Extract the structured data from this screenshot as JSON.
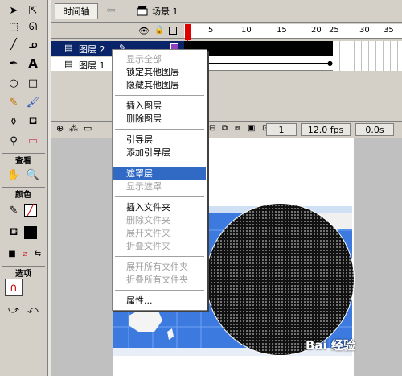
{
  "toolbar": {
    "timeline_button": "时间轴",
    "scene_label": "场景 1"
  },
  "timeline": {
    "ruler_numbers": [
      "1",
      "5",
      "10",
      "15",
      "20",
      "25",
      "30",
      "35"
    ],
    "layers": [
      {
        "name": "图层 2",
        "selected": true
      },
      {
        "name": "图层 1",
        "selected": false
      }
    ],
    "current_frame": "1",
    "fps": "12.0 fps",
    "time": "0.0s"
  },
  "tools": {
    "section_view": "查看",
    "section_colors": "颜色",
    "section_options": "选项"
  },
  "context_menu": {
    "items": [
      {
        "label": "显示全部",
        "enabled": false
      },
      {
        "label": "锁定其他图层",
        "enabled": true
      },
      {
        "label": "隐藏其他图层",
        "enabled": true
      },
      {
        "label": "插入图层",
        "enabled": true
      },
      {
        "label": "删除图层",
        "enabled": true
      },
      {
        "label": "引导层",
        "enabled": true
      },
      {
        "label": "添加引导层",
        "enabled": true
      },
      {
        "label": "遮罩层",
        "enabled": true,
        "highlighted": true
      },
      {
        "label": "显示遮罩",
        "enabled": false
      },
      {
        "label": "插入文件夹",
        "enabled": true
      },
      {
        "label": "删除文件夹",
        "enabled": false
      },
      {
        "label": "展开文件夹",
        "enabled": false
      },
      {
        "label": "折叠文件夹",
        "enabled": false
      },
      {
        "label": "展开所有文件夹",
        "enabled": false
      },
      {
        "label": "折叠所有文件夹",
        "enabled": false
      },
      {
        "label": "属性...",
        "enabled": true
      }
    ]
  },
  "watermark": "Bai 经验",
  "colors": {
    "selection": "#0a246a",
    "menu_highlight": "#316ac5",
    "playhead": "#e00000",
    "map_ocean": "#2f6ccf"
  }
}
